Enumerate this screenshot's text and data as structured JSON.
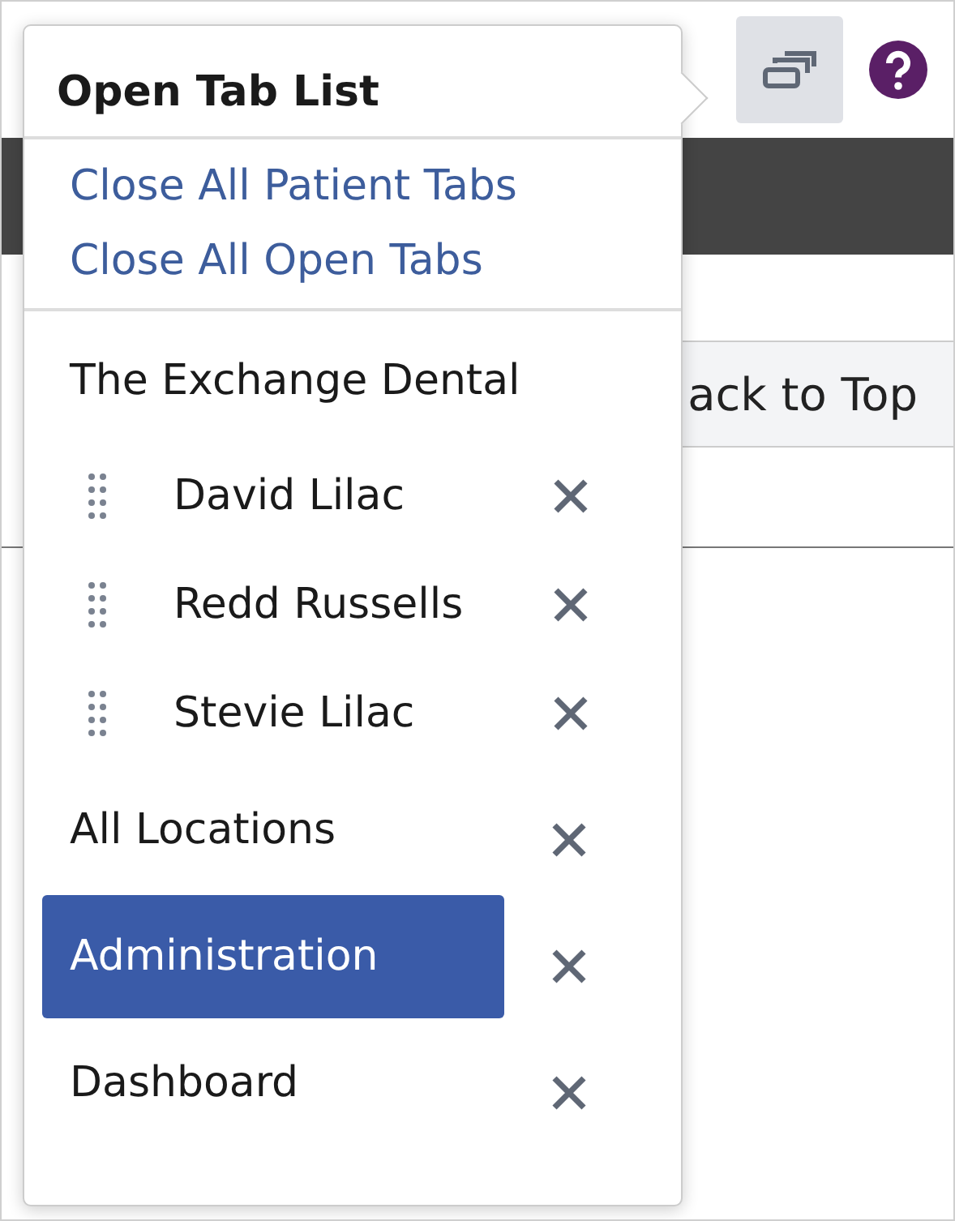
{
  "page": {
    "back_to_top": "ack to Top"
  },
  "popover": {
    "title": "Open Tab List",
    "actions": [
      "Close All Patient Tabs",
      "Close All Open Tabs"
    ],
    "items": [
      {
        "kind": "group",
        "label": "The Exchange Dental",
        "selected": false
      },
      {
        "kind": "patient",
        "label": "David Lilac",
        "selected": false
      },
      {
        "kind": "patient",
        "label": "Redd Russells",
        "selected": false
      },
      {
        "kind": "patient",
        "label": "Stevie Lilac",
        "selected": false
      },
      {
        "kind": "tab",
        "label": "All Locations",
        "selected": false
      },
      {
        "kind": "tab",
        "label": "Administration",
        "selected": true
      },
      {
        "kind": "tab",
        "label": "Dashboard",
        "selected": false
      }
    ]
  }
}
